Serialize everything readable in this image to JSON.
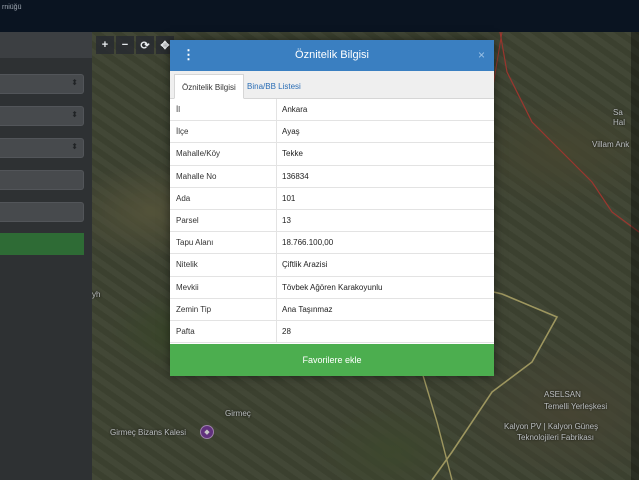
{
  "app": {
    "brand": "rniüğü"
  },
  "map": {
    "tools": [
      "+",
      "−",
      "⟳",
      "✥"
    ],
    "labels": {
      "girmec": "Girmeç",
      "girmec_kalesi": "Girmeç Bizans Kalesi",
      "aselsan": "ASELSAN",
      "yerleskesi": "Temelli Yerleşkesi",
      "kalyon": "Kalyon PV | Kalyon Güneş",
      "fabrikasi": "Teknolojileri Fabrikası",
      "villam": "Villam Ank",
      "sa": "Sa",
      "hal": "Hal",
      "yh": "yh"
    }
  },
  "modal": {
    "title": "Öznitelik Bilgisi",
    "close": "×",
    "tabs": [
      "Öznitelik Bilgisi",
      "Bina/BB Listesi"
    ],
    "rows": [
      {
        "key": "İl",
        "value": "Ankara"
      },
      {
        "key": "İlçe",
        "value": "Ayaş"
      },
      {
        "key": "Mahalle/Köy",
        "value": "Tekke"
      },
      {
        "key": "Mahalle No",
        "value": "136834"
      },
      {
        "key": "Ada",
        "value": "101"
      },
      {
        "key": "Parsel",
        "value": "13"
      },
      {
        "key": "Tapu Alanı",
        "value": "18.766.100,00"
      },
      {
        "key": "Nitelik",
        "value": "Çiftlik Arazisi"
      },
      {
        "key": "Mevkii",
        "value": "Tövbek Ağören Karakoyunlu"
      },
      {
        "key": "Zemin Tip",
        "value": "Ana Taşınmaz"
      },
      {
        "key": "Pafta",
        "value": "28"
      }
    ],
    "favorite_label": "Favorilere ekle"
  },
  "colors": {
    "header": "#3a7fc1",
    "favorite": "#4cae4f",
    "topbar": "#0d1a2b",
    "parcel_boundary": "#c9c07a",
    "district_line": "#c8463c"
  },
  "icons": {
    "menu": "kebab-menu-icon",
    "close": "close-icon",
    "pin": "landmark-pin-icon"
  }
}
